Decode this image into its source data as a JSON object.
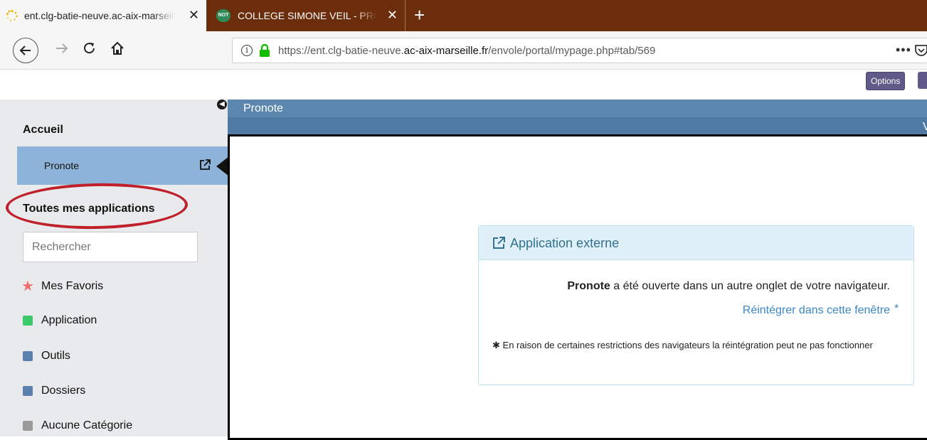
{
  "browser": {
    "tabs": [
      {
        "title": "ent.clg-batie-neuve.ac-aix-marseille.fr",
        "active": true
      },
      {
        "title": "COLLEGE SIMONE VEIL - PRONOTE",
        "favicon_text": "NOT",
        "active": false
      }
    ],
    "url": {
      "prefix": "https://ent.clg-batie-neuve.",
      "domain": "ac-aix-marseille.fr",
      "path": "/envole/portal/mypage.php#tab/569"
    },
    "more_label": "•••"
  },
  "page": {
    "options_label": "Options",
    "header_title": "Pronote",
    "header_right": "V"
  },
  "sidebar": {
    "home_heading": "Accueil",
    "active_item": "Pronote",
    "apps_heading": "Toutes mes applications",
    "search_placeholder": "Rechercher",
    "categories": [
      {
        "label": "Mes Favoris",
        "icon": "star-icon",
        "color": "#f07070"
      },
      {
        "label": "Application",
        "icon": "square",
        "color": "#3cc96a"
      },
      {
        "label": "Outils",
        "icon": "square",
        "color": "#5b80ad"
      },
      {
        "label": "Dossiers",
        "icon": "square",
        "color": "#5b80ad"
      },
      {
        "label": "Aucune Catégorie",
        "icon": "square",
        "color": "#9a9a9a"
      }
    ]
  },
  "panel": {
    "title": "Application externe",
    "message_bold": "Pronote",
    "message_rest": " a été ouverte dans un autre onglet de votre navigateur.",
    "reintegrate_link": "Réintégrer dans cette fenêtre",
    "note_star": "✱",
    "note": "En raison de certaines restrictions des navigateurs la réintégration peut ne pas fonctionner"
  },
  "colors": {
    "tabbar": "#6b2d0c",
    "header_blue": "#5b86ae",
    "active_item": "#8db4d8",
    "annotation_red": "#c0202a",
    "options_purple": "#5f5a88"
  }
}
